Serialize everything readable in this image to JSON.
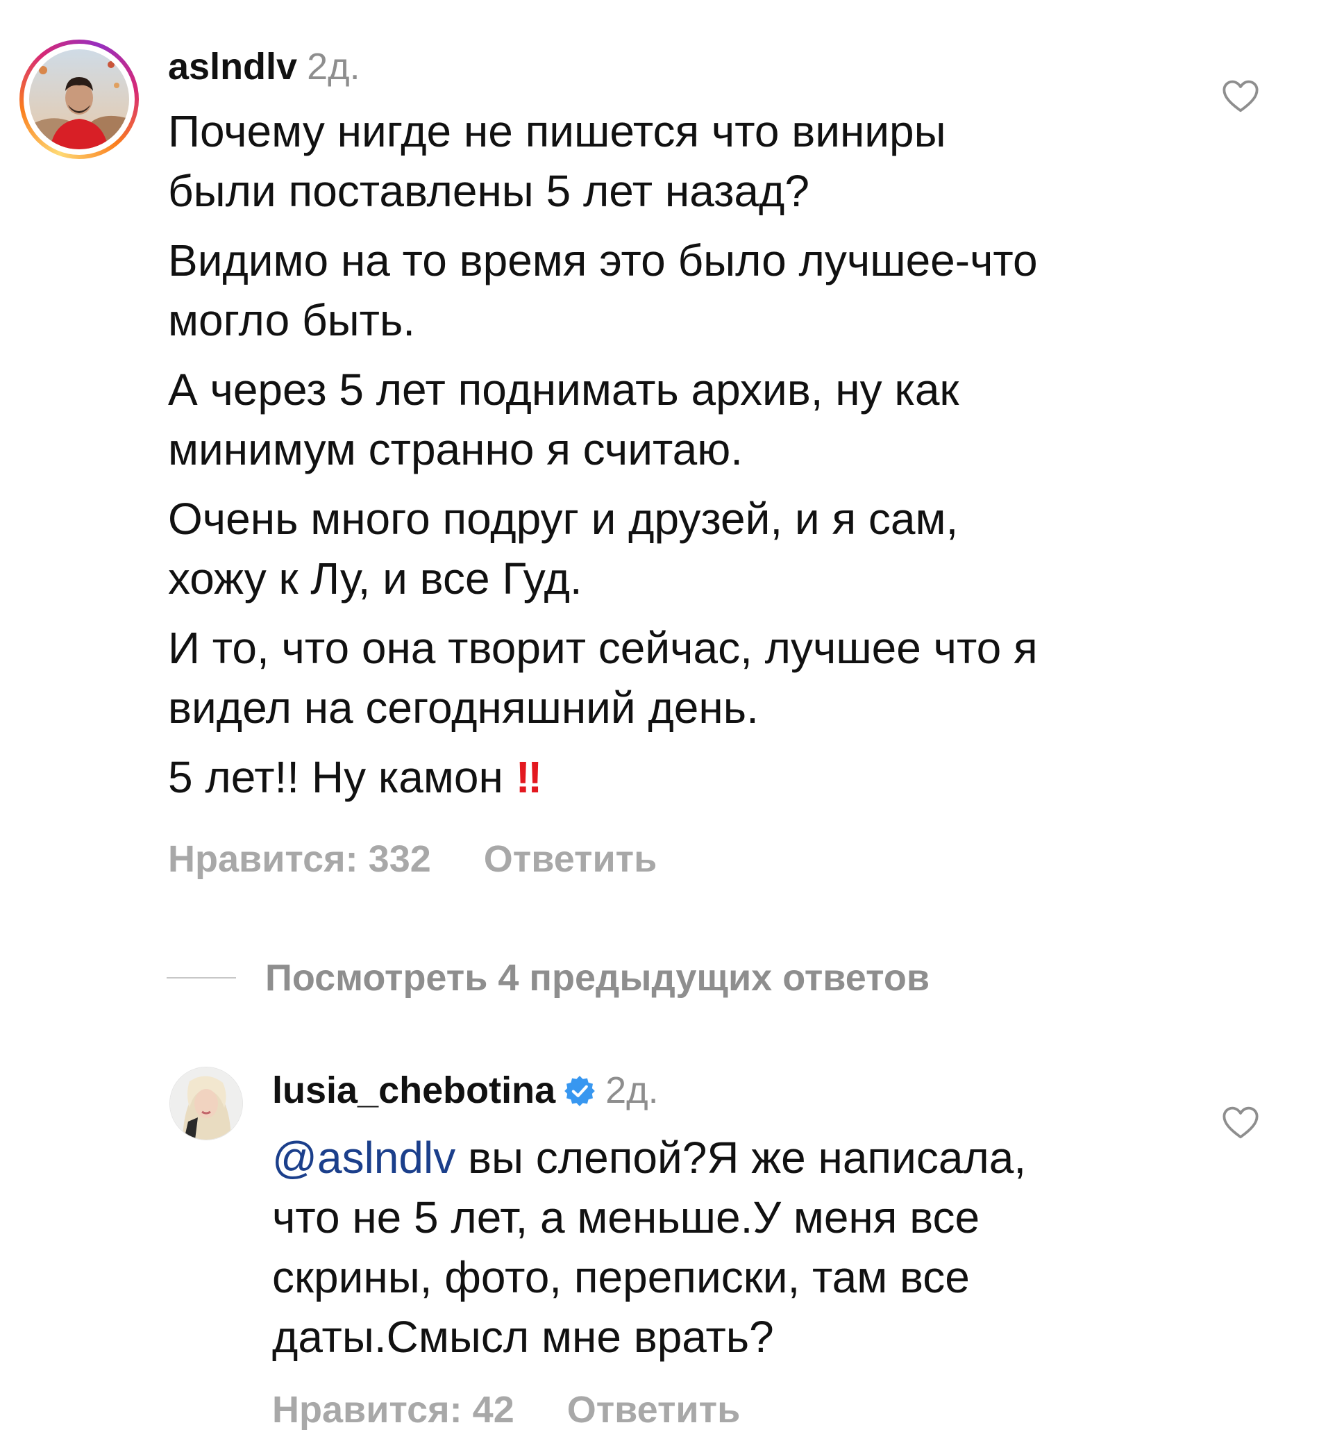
{
  "comments": [
    {
      "username": "aslndlv",
      "time": "2д.",
      "paragraphs": [
        [
          "Почему нигде не пишется что виниры",
          "были поставлены 5 лет назад?"
        ],
        [
          "Видимо на то время это было лучшее-что",
          "могло быть."
        ],
        [
          "А через 5 лет поднимать архив, ну как",
          "минимум странно я считаю."
        ],
        [
          "Очень много подруг и друзей, и я сам,",
          "хожу к Лу, и все Гуд."
        ],
        [
          "И то, что она творит сейчас, лучшее что я",
          "видел на сегодняшний день."
        ]
      ],
      "last_line": "5 лет!! Ну камон",
      "emoji": "‼",
      "likes_label": "Нравится: 332",
      "reply_label": "Ответить",
      "like_icon": "heart-outline-icon"
    },
    {
      "username": "lusia_chebotina",
      "verified": true,
      "time": "2д.",
      "mention": "@aslndlv",
      "lines": [
        " вы слепой?Я же написала,",
        "что не 5 лет, а меньше.У меня все",
        "скрины, фото, переписки, там все",
        "даты.Смысл мне врать?"
      ],
      "likes_label": "Нравится: 42",
      "reply_label": "Ответить",
      "like_icon": "heart-outline-icon"
    }
  ],
  "view_replies_label": "Посмотреть 4 предыдущих ответов",
  "colors": {
    "text": "#111111",
    "muted": "#8e8e8e",
    "action": "#a8a8a8",
    "mention": "#1b3f8b",
    "verified": "#3897f0",
    "emoji": "#e3181f"
  }
}
